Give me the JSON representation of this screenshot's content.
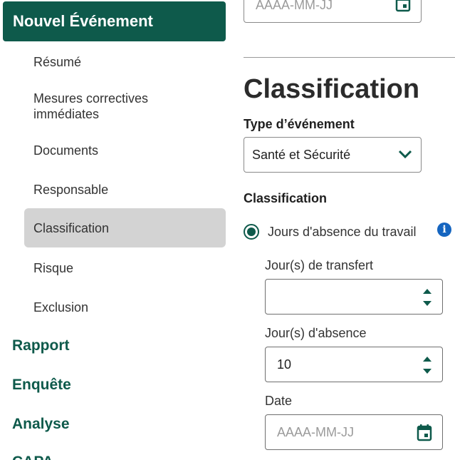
{
  "sidebar": {
    "header": "Nouvel Événement",
    "subitems": [
      {
        "label": "Résumé"
      },
      {
        "label": "Mesures correctives immédiates"
      },
      {
        "label": "Documents"
      },
      {
        "label": "Responsable"
      },
      {
        "label": "Classification",
        "active": true
      },
      {
        "label": "Risque"
      },
      {
        "label": "Exclusion"
      }
    ],
    "sections": [
      "Rapport",
      "Enquête",
      "Analyse",
      "CAPA"
    ]
  },
  "main": {
    "top_date_placeholder": "AAAA-MM-JJ",
    "title": "Classification",
    "event_type": {
      "label": "Type d’événement",
      "selected": "Santé et Sécurité"
    },
    "classification": {
      "label": "Classification",
      "radio_label": "Jours d'absence du travail",
      "radio_selected": true
    },
    "fields": {
      "transfer_days": {
        "label": "Jour(s) de transfert",
        "value": ""
      },
      "absence_days": {
        "label": "Jour(s) d'absence",
        "value": "10"
      },
      "date": {
        "label": "Date",
        "placeholder": "AAAA-MM-JJ"
      }
    }
  },
  "colors": {
    "brand": "#0e5a4b",
    "active_bg": "#d3d3d3",
    "info": "#1565c0"
  }
}
